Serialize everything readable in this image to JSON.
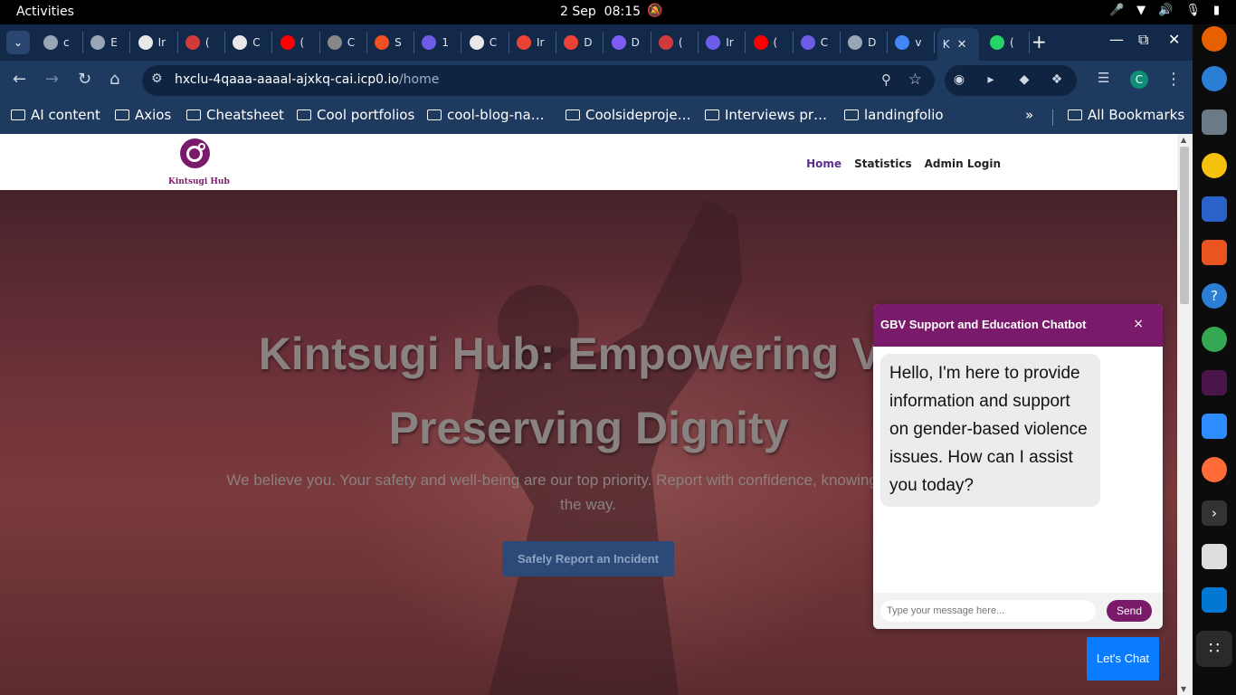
{
  "topbar": {
    "activities": "Activities",
    "date": "2 Sep",
    "time": "08:15"
  },
  "browser": {
    "tabs": [
      {
        "title": "c",
        "favicon": "globe-icon",
        "color": "#9aa6b5"
      },
      {
        "title": "E",
        "favicon": "globe-icon",
        "color": "#9aa6b5"
      },
      {
        "title": "Ir",
        "favicon": "notion-icon",
        "color": "#e8e8e8"
      },
      {
        "title": "(",
        "favicon": "badge-743-icon",
        "color": "#d23b3b"
      },
      {
        "title": "C",
        "favicon": "chatgpt-icon",
        "color": "#e8e8e8"
      },
      {
        "title": "(",
        "favicon": "youtube-icon",
        "color": "#ff0000"
      },
      {
        "title": "C",
        "favicon": "nyt-icon",
        "color": "#888888"
      },
      {
        "title": "S",
        "favicon": "microsoft-icon",
        "color": "#f25022"
      },
      {
        "title": "1",
        "favicon": "icp-icon",
        "color": "#6c5ce7"
      },
      {
        "title": "C",
        "favicon": "github-icon",
        "color": "#e8e8e8"
      },
      {
        "title": "Ir",
        "favicon": "gmail-icon",
        "color": "#ea4335"
      },
      {
        "title": "D",
        "favicon": "gmail-icon",
        "color": "#ea4335"
      },
      {
        "title": "D",
        "favicon": "extension-icon",
        "color": "#7c5cf2"
      },
      {
        "title": "(",
        "favicon": "badge-743-icon",
        "color": "#d23b3b"
      },
      {
        "title": "Ir",
        "favicon": "icp-icon",
        "color": "#6c5ce7"
      },
      {
        "title": "(",
        "favicon": "youtube-icon",
        "color": "#ff0000"
      },
      {
        "title": "C",
        "favicon": "icp-icon",
        "color": "#6c5ce7"
      },
      {
        "title": "D",
        "favicon": "globe-icon",
        "color": "#9aa6b5"
      },
      {
        "title": "v",
        "favicon": "google-icon",
        "color": "#4285f4"
      },
      {
        "title": "K",
        "favicon": "",
        "color": "#1f3a5f",
        "active": true
      },
      {
        "title": "(",
        "favicon": "whatsapp-icon",
        "color": "#25d366"
      }
    ],
    "url_host": "hxclu-4qaaa-aaaal-ajxkq-cai.icp0.io",
    "url_path": "/home",
    "profile_initial": "C",
    "bookmarks": [
      "AI content",
      "Axios",
      "Cheatsheet",
      "Cool portfolios",
      "cool-blog-na…",
      "Coolsideproje…",
      "Interviews pr…",
      "landingfolio"
    ],
    "all_bookmarks": "All Bookmarks"
  },
  "site": {
    "logo_text": "Kintsugi Hub",
    "brand": "Kintsugi",
    "nav": {
      "home": "Home",
      "statistics": "Statistics",
      "admin_login": "Admin Login"
    },
    "hero": {
      "title_line1": "Kintsugi Hub: Empowering Voi",
      "title_line2": "Preserving Dignity",
      "tagline_line1": "We believe you. Your safety and well-being are our top priority. Report with confidence, knowing you're pro",
      "tagline_line2": "the way.",
      "cta": "Safely Report an Incident"
    }
  },
  "chat": {
    "title": "GBV Support and Education Chatbot",
    "close": "×",
    "greeting": "Hello, I'm here to provide information and support on gender-based violence issues. How can I assist you today?",
    "input_placeholder": "Type your message here...",
    "send": "Send",
    "launcher": "Let's Chat"
  },
  "colors": {
    "brand_purple": "#7a1a6a",
    "chrome_bg": "#1f3a5f",
    "launcher_blue": "#0a7cff"
  }
}
